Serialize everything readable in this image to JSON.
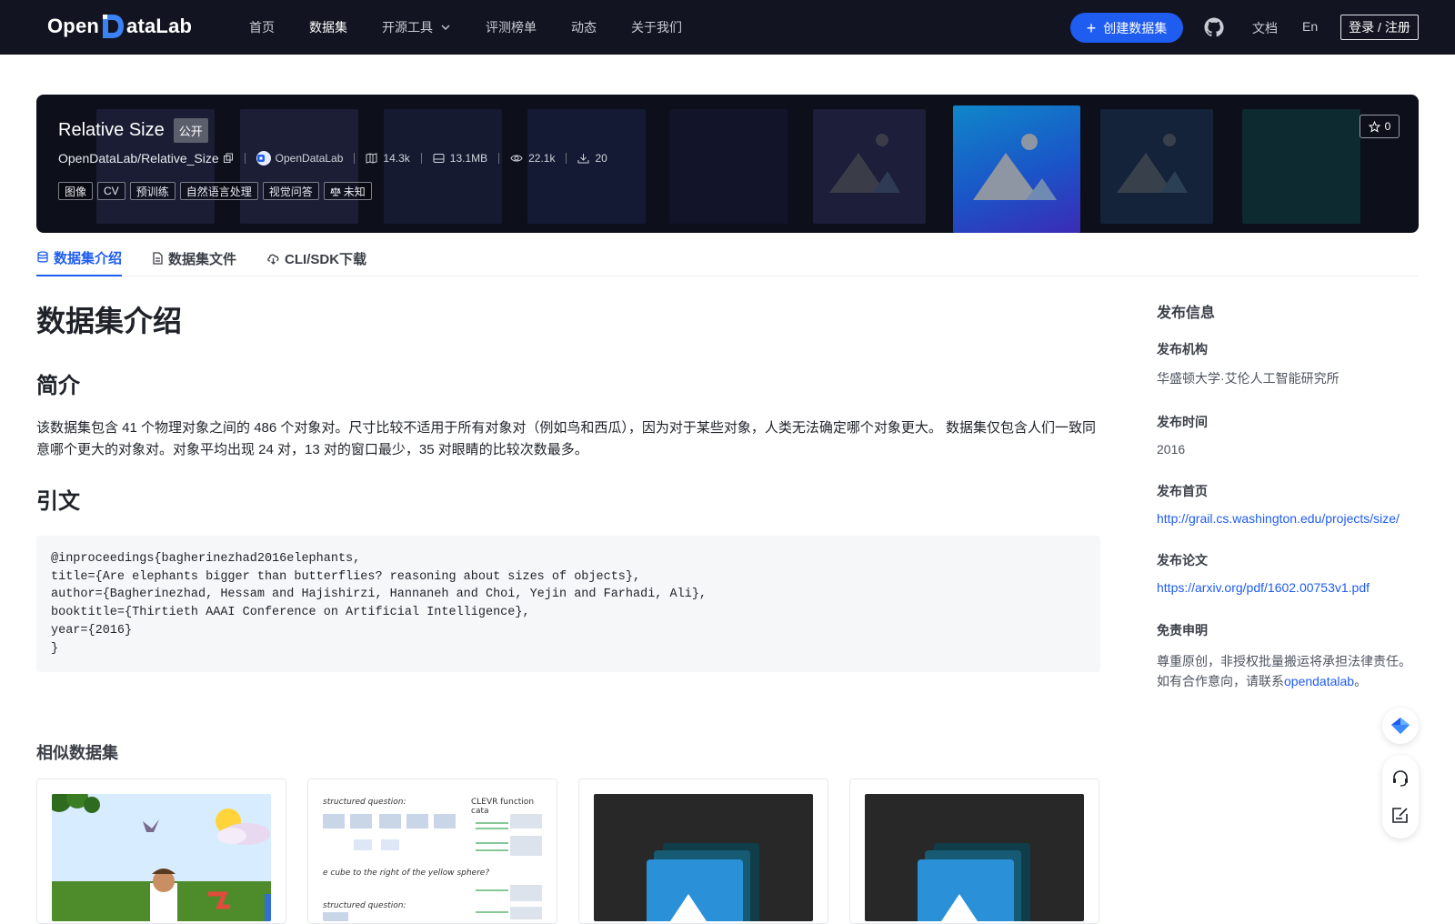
{
  "nav": {
    "logo_left": "Open",
    "logo_right": "ataLab",
    "items": [
      {
        "label": "首页"
      },
      {
        "label": "数据集"
      },
      {
        "label": "开源工具"
      },
      {
        "label": "评测榜单"
      },
      {
        "label": "动态"
      },
      {
        "label": "关于我们"
      }
    ],
    "create_label": "创建数据集",
    "docs_label": "文档",
    "lang_label": "En",
    "login_label": "登录 / 注册"
  },
  "banner": {
    "title": "Relative Size",
    "visibility": "公开",
    "repo": "OpenDataLab/Relative_Size",
    "org": "OpenDataLab",
    "files": "14.3k",
    "size": "13.1MB",
    "views": "22.1k",
    "downloads": "20",
    "tags": [
      "图像",
      "CV",
      "预训练",
      "自然语言处理",
      "视觉问答"
    ],
    "license": "未知",
    "stars": "0"
  },
  "tabs": [
    {
      "label": "数据集介绍"
    },
    {
      "label": "数据集文件"
    },
    {
      "label": "CLI/SDK下载"
    }
  ],
  "content": {
    "page_title": "数据集介绍",
    "intro_heading": "简介",
    "intro_text": "该数据集包含 41 个物理对象之间的 486 个对象对。尺寸比较不适用于所有对象对（例如鸟和西瓜），因为对于某些对象，人类无法确定哪个对象更大。 数据集仅包含人们一致同意哪个更大的对象对。对象平均出现 24 对，13 对的窗口最少，35 对眼睛的比较次数最多。",
    "citation_heading": "引文",
    "citation": "@inproceedings{bagherinezhad2016elephants,\ntitle={Are elephants bigger than butterflies? reasoning about sizes of objects},\nauthor={Bagherinezhad, Hessam and Hajishirzi, Hannaneh and Choi, Yejin and Farhadi, Ali},\nbooktitle={Thirtieth AAAI Conference on Artificial Intelligence},\nyear={2016}\n}"
  },
  "sidebar": {
    "title": "发布信息",
    "org_label": "发布机构",
    "org_value": "华盛顿大学·艾伦人工智能研究所",
    "time_label": "发布时间",
    "time_value": "2016",
    "home_label": "发布首页",
    "home_value": "http://grail.cs.washington.edu/projects/size/",
    "paper_label": "发布论文",
    "paper_value": "https://arxiv.org/pdf/1602.00753v1.pdf",
    "disclaimer_label": "免责申明",
    "disclaimer_line1": "尊重原创，非授权批量搬运将承担法律责任。",
    "disclaimer_line2_prefix": "如有合作意向，请联系",
    "disclaimer_link": "opendatalab",
    "disclaimer_line2_suffix": "。"
  },
  "similar": {
    "title": "相似数据集",
    "card2_lines": [
      "structured question:",
      "CLEVR function cata",
      "e cube to the right of the yellow sphere?",
      "structured question:"
    ]
  },
  "colors": {
    "accent": "#1f5cf0",
    "nav_bg": "#121421"
  }
}
